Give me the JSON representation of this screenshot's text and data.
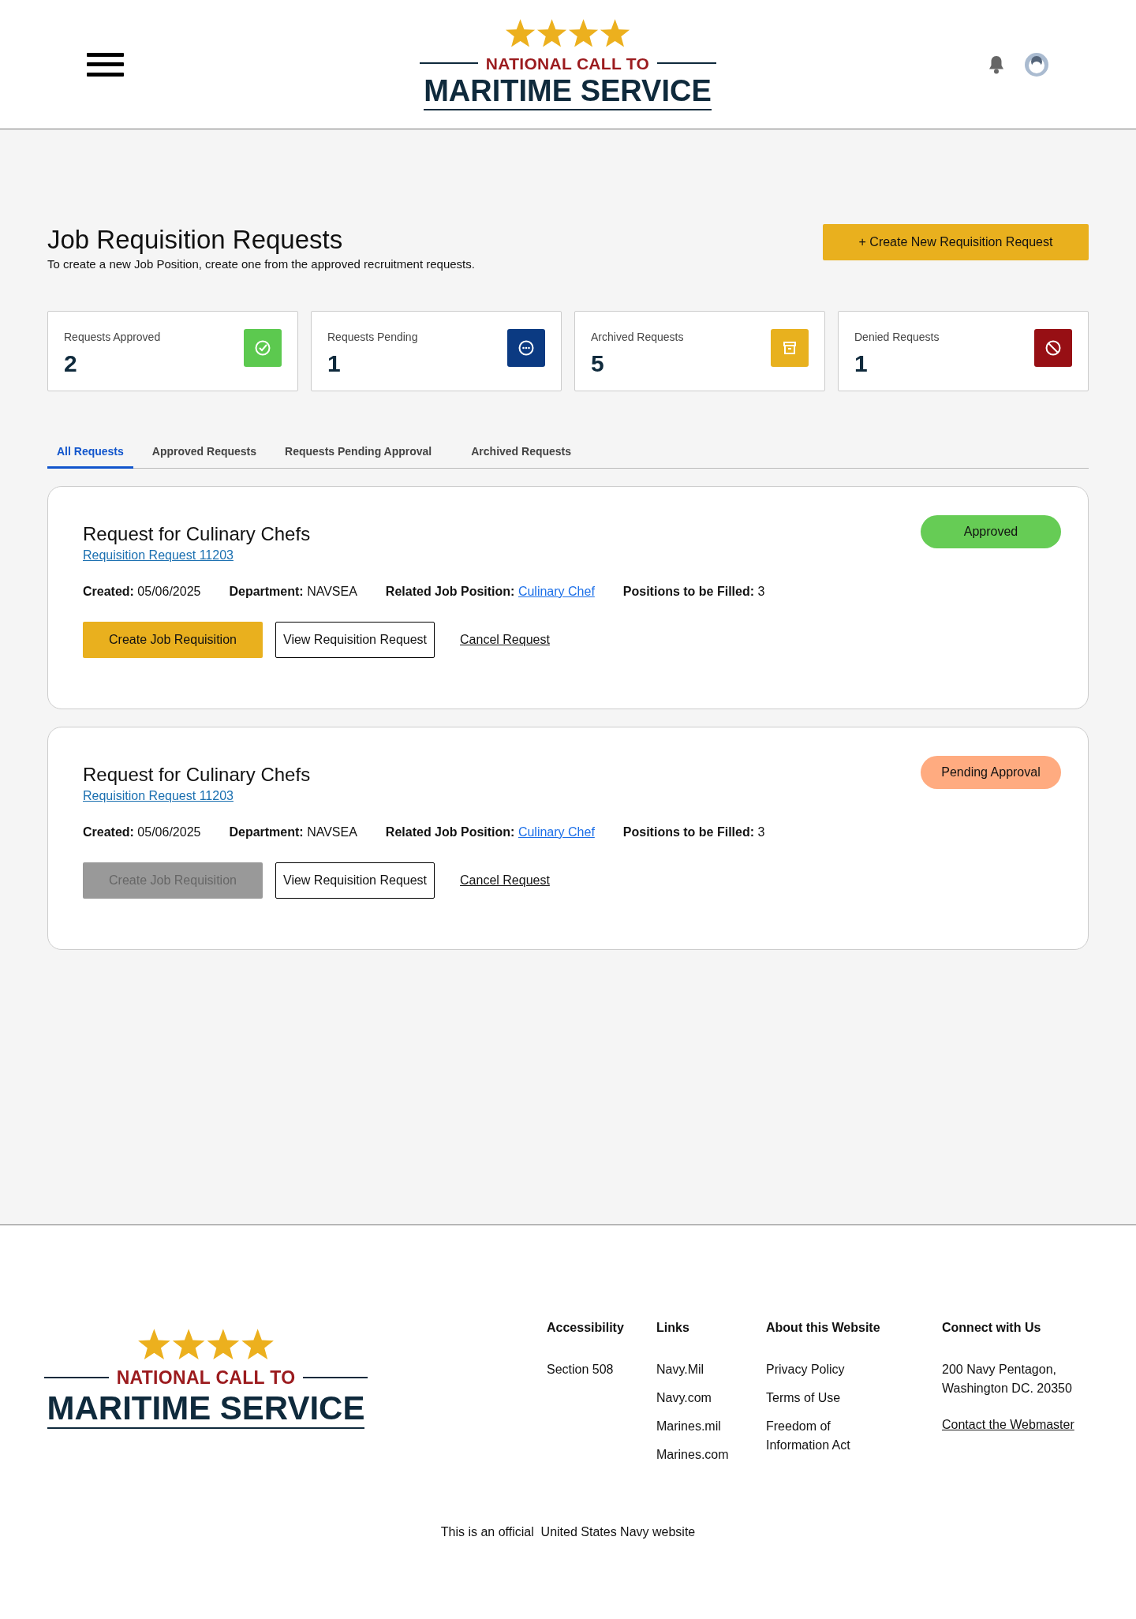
{
  "header": {
    "logo": {
      "line1": "NATIONAL CALL TO",
      "line2": "MARITIME SERVICE"
    }
  },
  "page": {
    "title": "Job Requisition Requests",
    "subtitle": "To create a new Job Position, create one from the approved recruitment requests.",
    "create_button": "+ Create New Requisition Request"
  },
  "stats": [
    {
      "label": "Requests Approved",
      "value": "2",
      "kind": "approved",
      "color": "#5cc94f"
    },
    {
      "label": "Requests Pending",
      "value": "1",
      "kind": "pending",
      "color": "#0b3a82"
    },
    {
      "label": "Archived Requests",
      "value": "5",
      "kind": "archived",
      "color": "#e8b11e"
    },
    {
      "label": "Denied Requests",
      "value": "1",
      "kind": "denied",
      "color": "#970f14"
    }
  ],
  "tabs": [
    {
      "label": "All Requests",
      "selected": true
    },
    {
      "label": "Approved Requests",
      "selected": false
    },
    {
      "label": "Requests Pending Approval",
      "selected": false
    },
    {
      "label": "Archived Requests",
      "selected": false
    }
  ],
  "requests": [
    {
      "title": "Request for Culinary Chefs",
      "link": "Requisition Request 11203",
      "status": "Approved",
      "color": "#66cc55",
      "fields": [
        {
          "label": "Created:",
          "value": "05/06/2025",
          "kind": "text"
        },
        {
          "label": "Department:",
          "value": "NAVSEA",
          "kind": "text"
        },
        {
          "label": "Related Job Position:",
          "value": "Culinary Chef",
          "kind": "link"
        },
        {
          "label": "Positions to be Filled:",
          "value": "3",
          "kind": "text"
        }
      ],
      "create_button": {
        "label": "Create Job Requisition",
        "disabled": false
      },
      "view_button": "View Requisition Request",
      "cancel_link": "Cancel Request"
    },
    {
      "title": "Request for Culinary Chefs",
      "link": "Requisition Request 11203",
      "status": "Pending Approval",
      "color": "#ffab80",
      "fields": [
        {
          "label": "Created:",
          "value": "05/06/2025",
          "kind": "text"
        },
        {
          "label": "Department:",
          "value": "NAVSEA",
          "kind": "text"
        },
        {
          "label": "Related Job Position:",
          "value": "Culinary Chef",
          "kind": "link"
        },
        {
          "label": "Positions to be Filled:",
          "value": "3",
          "kind": "text"
        }
      ],
      "create_button": {
        "label": "Create Job Requisition",
        "disabled": true
      },
      "view_button": "View Requisition Request",
      "cancel_link": "Cancel Request"
    }
  ],
  "footer": {
    "logo": {
      "line1": "NATIONAL CALL TO",
      "line2": "MARITIME SERVICE"
    },
    "columns": [
      {
        "heading": "Accessibility",
        "items": [
          {
            "text": "Section 508",
            "kind": "link"
          }
        ]
      },
      {
        "heading": "Links",
        "items": [
          {
            "text": "Navy.Mil",
            "kind": "link"
          },
          {
            "text": "Navy.com",
            "kind": "link"
          },
          {
            "text": "Marines.mil",
            "kind": "link"
          },
          {
            "text": "Marines.com",
            "kind": "link"
          }
        ]
      },
      {
        "heading": "About this Website",
        "items": [
          {
            "text": "Privacy Policy",
            "kind": "link"
          },
          {
            "text": "Terms of Use",
            "kind": "link"
          },
          {
            "text": "Freedom of Information Act",
            "kind": "link"
          }
        ]
      },
      {
        "heading": "Connect with Us",
        "items": [
          {
            "text": "200 Navy Pentagon, Washington DC. 20350",
            "kind": "text"
          },
          {
            "text": "Contact the Webmaster",
            "kind": "underlined"
          }
        ]
      }
    ],
    "notice": "This is an official  United States Navy website"
  }
}
